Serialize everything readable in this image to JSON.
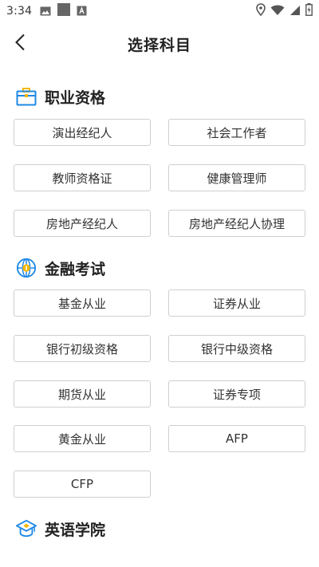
{
  "status_bar": {
    "time": "3:34",
    "icons_left": [
      "gallery-icon",
      "square-icon",
      "a-box-icon"
    ],
    "icons_right": [
      "location-icon",
      "wifi-icon",
      "signal-icon",
      "battery-charging-icon"
    ]
  },
  "header": {
    "title": "选择科目",
    "back_icon": "chevron-left-icon"
  },
  "sections": [
    {
      "title": "职业资格",
      "icon": "briefcase-icon",
      "items": [
        "演出经纪人",
        "社会工作者",
        "教师资格证",
        "健康管理师",
        "房地产经纪人",
        "房地产经纪人协理"
      ]
    },
    {
      "title": "金融考试",
      "icon": "globe-coin-icon",
      "items": [
        "基金从业",
        "证券从业",
        "银行初级资格",
        "银行中级资格",
        "期货从业",
        "证券专项",
        "黄金从业",
        "AFP",
        "CFP"
      ]
    },
    {
      "title": "英语学院",
      "icon": "graduation-cap-icon",
      "items": []
    }
  ],
  "colors": {
    "accent_blue": "#1e88e5",
    "icon_gold": "#f5b800",
    "border": "#cfcfcf"
  }
}
